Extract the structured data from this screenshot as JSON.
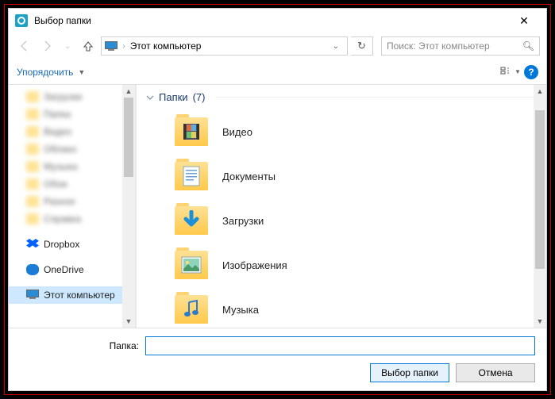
{
  "title": "Выбор папки",
  "address": {
    "root": "Этот компьютер"
  },
  "search": {
    "placeholder": "Поиск: Этот компьютер"
  },
  "toolbar": {
    "organize": "Упорядочить"
  },
  "nav": {
    "blurred": [
      {
        "label": "Загрузки"
      },
      {
        "label": "Папка"
      },
      {
        "label": "Видео"
      },
      {
        "label": "Облако"
      },
      {
        "label": "Музыка"
      },
      {
        "label": "Обои"
      },
      {
        "label": "Разное"
      },
      {
        "label": "Справка"
      }
    ],
    "items": [
      {
        "label": "Dropbox",
        "icon": "dropbox"
      },
      {
        "label": "OneDrive",
        "icon": "onedrive"
      },
      {
        "label": "Этот компьютер",
        "icon": "pc",
        "selected": true
      }
    ]
  },
  "group": {
    "label": "Папки",
    "count": "(7)"
  },
  "items": [
    {
      "label": "Видео",
      "kind": "video"
    },
    {
      "label": "Документы",
      "kind": "docs"
    },
    {
      "label": "Загрузки",
      "kind": "downloads"
    },
    {
      "label": "Изображения",
      "kind": "pictures"
    },
    {
      "label": "Музыка",
      "kind": "music"
    }
  ],
  "footer": {
    "label": "Папка:",
    "value": "",
    "select": "Выбор папки",
    "cancel": "Отмена"
  }
}
